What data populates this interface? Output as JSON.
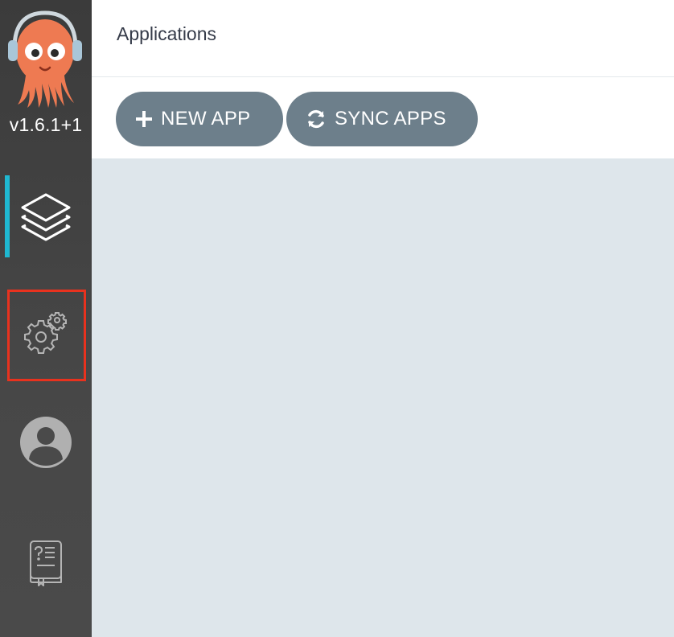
{
  "sidebar": {
    "version": "v1.6.1+1",
    "items": [
      {
        "name": "applications",
        "icon": "layers-icon",
        "active": true
      },
      {
        "name": "settings",
        "icon": "gears-icon",
        "highlighted": true
      },
      {
        "name": "user-info",
        "icon": "user-avatar-icon"
      },
      {
        "name": "documentation",
        "icon": "help-book-icon"
      }
    ],
    "active_color": "#1fb8d1",
    "highlight_color": "#e8321e"
  },
  "header": {
    "title": "Applications"
  },
  "toolbar": {
    "new_app_label": "NEW APP",
    "sync_apps_label": "SYNC APPS",
    "button_color": "#6d7f8b"
  }
}
